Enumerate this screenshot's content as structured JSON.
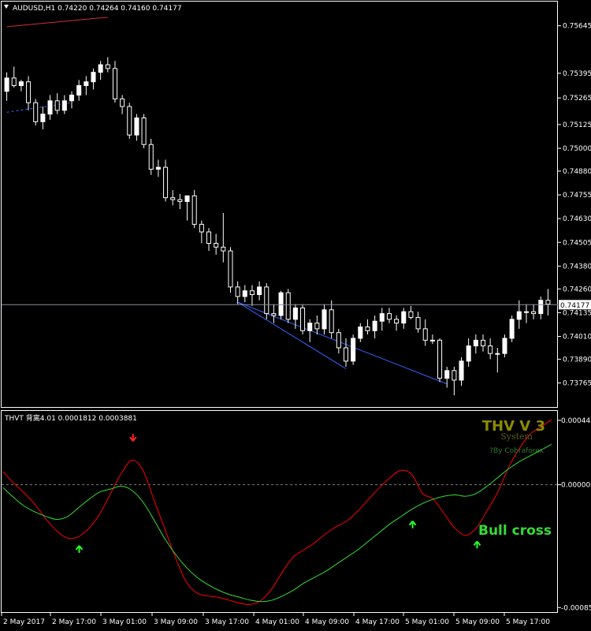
{
  "main_panel": {
    "info_line": "AUDUSD,H1  0.74220 0.74264 0.74160 0.74177",
    "symbol": "AUDUSD,H1",
    "ohlc": {
      "open": 0.7422,
      "high": 0.74264,
      "low": 0.7416,
      "close": 0.74177
    },
    "current_price_label": "0.74177"
  },
  "indicator_panel": {
    "info_line": "THVT 背离4.01 0.0001812 0.0003881",
    "name": "THVT 背离4.01",
    "values": [
      0.0001812,
      0.0003881
    ],
    "brand_title": "THV V 3",
    "brand_subtitle": "System",
    "brand_credit": "?By Cobraforex",
    "signal_text": "Bull cross",
    "colors": {
      "fast": "#ff0000",
      "slow": "#33dd33",
      "up_arrow": "#22ff22",
      "down_arrow": "#ff2222",
      "brand_title": "#8b8b00"
    }
  },
  "chart_data": [
    {
      "type": "candlestick",
      "title": "AUDUSD,H1",
      "ylabels": [
        "0.75645",
        "0.75395",
        "0.75265",
        "0.75125",
        "0.75000",
        "0.74880",
        "0.74755",
        "0.74630",
        "0.74505",
        "0.74380",
        "0.74260",
        "0.74135",
        "0.74010",
        "0.73890",
        "0.73765"
      ],
      "ylim": [
        0.7368,
        0.7571
      ],
      "current_price": 0.74177,
      "candles": [
        [
          0.753,
          0.754,
          0.7525,
          0.7537
        ],
        [
          0.7537,
          0.7543,
          0.7532,
          0.7533
        ],
        [
          0.7533,
          0.7536,
          0.753,
          0.7535
        ],
        [
          0.7535,
          0.7538,
          0.752,
          0.7524
        ],
        [
          0.7524,
          0.7526,
          0.7512,
          0.7514
        ],
        [
          0.7514,
          0.7522,
          0.751,
          0.7518
        ],
        [
          0.7518,
          0.7528,
          0.7515,
          0.7525
        ],
        [
          0.7525,
          0.7529,
          0.7518,
          0.752
        ],
        [
          0.752,
          0.7528,
          0.7518,
          0.7525
        ],
        [
          0.7525,
          0.753,
          0.7521,
          0.7528
        ],
        [
          0.7528,
          0.7536,
          0.7525,
          0.7533
        ],
        [
          0.7533,
          0.7538,
          0.7528,
          0.7535
        ],
        [
          0.7535,
          0.7542,
          0.7531,
          0.754
        ],
        [
          0.754,
          0.7546,
          0.7536,
          0.7544
        ],
        [
          0.7544,
          0.7548,
          0.754,
          0.7542
        ],
        [
          0.7542,
          0.7546,
          0.7524,
          0.7526
        ],
        [
          0.7526,
          0.7528,
          0.7518,
          0.7522
        ],
        [
          0.7522,
          0.7524,
          0.7505,
          0.7507
        ],
        [
          0.7507,
          0.7518,
          0.7504,
          0.7516
        ],
        [
          0.7516,
          0.7518,
          0.75,
          0.7502
        ],
        [
          0.7502,
          0.7505,
          0.7486,
          0.7489
        ],
        [
          0.7489,
          0.7494,
          0.7485,
          0.749
        ],
        [
          0.749,
          0.7494,
          0.7472,
          0.7474
        ],
        [
          0.7474,
          0.7478,
          0.747,
          0.7473
        ],
        [
          0.7473,
          0.7476,
          0.7468,
          0.7472
        ],
        [
          0.7472,
          0.7475,
          0.7462,
          0.7475
        ],
        [
          0.7475,
          0.7478,
          0.7458,
          0.746
        ],
        [
          0.746,
          0.7462,
          0.745,
          0.7456
        ],
        [
          0.7456,
          0.7458,
          0.7446,
          0.745
        ],
        [
          0.745,
          0.7455,
          0.7444,
          0.7448
        ],
        [
          0.7448,
          0.7466,
          0.744,
          0.7446
        ],
        [
          0.7446,
          0.7448,
          0.7424,
          0.7427
        ],
        [
          0.7427,
          0.743,
          0.7418,
          0.7422
        ],
        [
          0.7422,
          0.7428,
          0.7419,
          0.7425
        ],
        [
          0.7425,
          0.7428,
          0.7417,
          0.7423
        ],
        [
          0.7423,
          0.743,
          0.742,
          0.7427
        ],
        [
          0.7427,
          0.7429,
          0.741,
          0.7413
        ],
        [
          0.7413,
          0.7418,
          0.7408,
          0.7412
        ],
        [
          0.7412,
          0.7425,
          0.741,
          0.7424
        ],
        [
          0.7424,
          0.7426,
          0.7408,
          0.741
        ],
        [
          0.741,
          0.7418,
          0.7405,
          0.7416
        ],
        [
          0.7416,
          0.7418,
          0.7402,
          0.7404
        ],
        [
          0.7404,
          0.741,
          0.7398,
          0.7408
        ],
        [
          0.7408,
          0.7412,
          0.7402,
          0.7405
        ],
        [
          0.7405,
          0.7418,
          0.7402,
          0.7415
        ],
        [
          0.7415,
          0.742,
          0.74,
          0.7403
        ],
        [
          0.7403,
          0.7405,
          0.7392,
          0.7395
        ],
        [
          0.7395,
          0.74,
          0.7385,
          0.7388
        ],
        [
          0.7388,
          0.7402,
          0.7386,
          0.74
        ],
        [
          0.74,
          0.7408,
          0.7398,
          0.7406
        ],
        [
          0.7406,
          0.741,
          0.7402,
          0.7404
        ],
        [
          0.7404,
          0.7412,
          0.74,
          0.7409
        ],
        [
          0.7409,
          0.7416,
          0.7404,
          0.7413
        ],
        [
          0.7413,
          0.7416,
          0.7408,
          0.741
        ],
        [
          0.741,
          0.7412,
          0.7404,
          0.7408
        ],
        [
          0.7408,
          0.7416,
          0.7405,
          0.7414
        ],
        [
          0.7414,
          0.7417,
          0.741,
          0.7411
        ],
        [
          0.7411,
          0.7414,
          0.7403,
          0.7405
        ],
        [
          0.7405,
          0.741,
          0.7396,
          0.7399
        ],
        [
          0.7399,
          0.7402,
          0.7397,
          0.7399
        ],
        [
          0.7399,
          0.74,
          0.7377,
          0.7379
        ],
        [
          0.7379,
          0.7385,
          0.7374,
          0.7383
        ],
        [
          0.7383,
          0.7385,
          0.737,
          0.7378
        ],
        [
          0.7378,
          0.739,
          0.7375,
          0.7388
        ],
        [
          0.7388,
          0.74,
          0.7385,
          0.7396
        ],
        [
          0.7396,
          0.7402,
          0.7392,
          0.7399
        ],
        [
          0.7399,
          0.7402,
          0.7393,
          0.7396
        ],
        [
          0.7396,
          0.74,
          0.7389,
          0.7392
        ],
        [
          0.7392,
          0.7395,
          0.7382,
          0.7392
        ],
        [
          0.7392,
          0.7402,
          0.739,
          0.74
        ],
        [
          0.74,
          0.7412,
          0.7398,
          0.741
        ],
        [
          0.741,
          0.742,
          0.7405,
          0.7414
        ],
        [
          0.7414,
          0.7418,
          0.7408,
          0.7414
        ],
        [
          0.7414,
          0.7418,
          0.741,
          0.7413
        ],
        [
          0.7413,
          0.7422,
          0.741,
          0.742
        ],
        [
          0.742,
          0.7426,
          0.7412,
          0.7418
        ]
      ],
      "trendlines": [
        {
          "color": "#d03030",
          "style": "solid",
          "from": [
            0,
            0.7564
          ],
          "to": [
            14,
            0.7569
          ]
        },
        {
          "color": "#3366ff",
          "style": "dashed",
          "from": [
            0,
            0.7519
          ],
          "to": [
            9,
            0.7524
          ]
        },
        {
          "color": "#3366ff",
          "style": "solid",
          "from": [
            32,
            0.7419
          ],
          "to": [
            47,
            0.7384
          ]
        },
        {
          "color": "#3366ff",
          "style": "solid",
          "from": [
            32,
            0.7419
          ],
          "to": [
            61,
            0.7376
          ]
        }
      ]
    },
    {
      "type": "line",
      "title": "THVT 背离4.01",
      "ylabels": [
        "0.0004460",
        "0.0000000",
        "-0.0008510"
      ],
      "ylim": [
        -0.000866,
        0.000462
      ],
      "zero_line": 0,
      "xlabels": [
        "2 May 2017",
        "2 May 17:00",
        "3 May 01:00",
        "3 May 09:00",
        "3 May 17:00",
        "4 May 01:00",
        "4 May 09:00",
        "4 May 17:00",
        "5 May 01:00",
        "5 May 09:00",
        "5 May 17:00"
      ],
      "series": [
        {
          "color": "#ff0000",
          "values": [
            9e-05,
            1e-05,
            -6e-05,
            -0.00014,
            -0.00024,
            -0.00032,
            -0.00037,
            -0.00036,
            -0.0003,
            -0.0002,
            -6e-05,
            8e-05,
            0.00017,
            0.0001,
            -0.0001,
            -0.0003,
            -0.0005,
            -0.00067,
            -0.00075,
            -0.00077,
            -0.00078,
            -0.0008,
            -0.00082,
            -0.00083,
            -0.0008,
            -0.00072,
            -0.0006,
            -0.0005,
            -0.00045,
            -0.0004,
            -0.00034,
            -0.00029,
            -0.00025,
            -0.00018,
            -0.0001,
            -2e-05,
            5e-05,
            0.0001,
            7e-05,
            -6e-05,
            -0.0001,
            -0.0002,
            -0.0003,
            -0.00035,
            -0.0003,
            -0.00018,
            -5e-05,
            0.00012,
            0.00025,
            0.00035,
            0.0004,
            0.00045
          ]
        },
        {
          "color": "#33dd33",
          "values": [
            -2e-05,
            -9e-05,
            -0.00015,
            -0.00019,
            -0.00022,
            -0.00024,
            -0.00022,
            -0.00016,
            -0.0001,
            -5e-05,
            -3e-05,
            -1e-05,
            -4e-05,
            -0.00012,
            -0.00024,
            -0.00037,
            -0.00048,
            -0.00057,
            -0.00064,
            -0.00069,
            -0.00073,
            -0.00076,
            -0.00078,
            -0.0008,
            -0.00081,
            -0.0008,
            -0.00077,
            -0.00073,
            -0.00068,
            -0.00064,
            -0.0006,
            -0.00055,
            -0.0005,
            -0.00045,
            -0.00039,
            -0.00033,
            -0.00027,
            -0.00022,
            -0.00017,
            -0.00013,
            -0.0001,
            -8e-05,
            -7e-05,
            -8e-05,
            -6e-05,
            -1e-05,
            5e-05,
            0.00011,
            0.00016,
            0.0002,
            0.00024,
            0.00028
          ]
        }
      ],
      "markers": [
        {
          "type": "up_arrow",
          "x": 7,
          "y": -0.00045
        },
        {
          "type": "down_arrow",
          "x": 12,
          "y": 0.00033
        },
        {
          "type": "up_arrow",
          "x": 38,
          "y": -0.00028
        },
        {
          "type": "up_arrow",
          "x": 44,
          "y": -0.00042
        }
      ]
    }
  ]
}
